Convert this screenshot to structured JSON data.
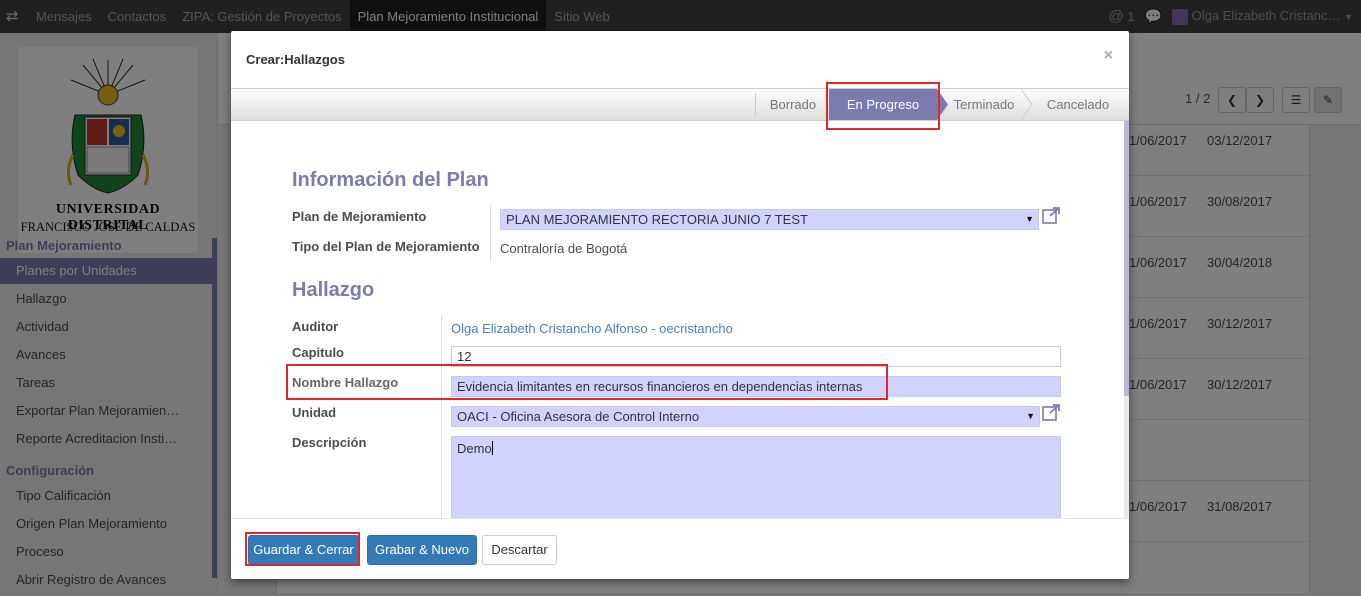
{
  "topbar": {
    "menus": [
      "Mensajes",
      "Contactos",
      "ZIPA: Gestión de Proyectos",
      "Plan Mejoramiento Institucional",
      "Sitio Web"
    ],
    "active_menu": "Plan Mejoramiento Institucional",
    "mentions_count": "1",
    "user_name": "Olga Elizabeth Cristanc…"
  },
  "logo": {
    "line1": "UNIVERSIDAD DISTRITAL",
    "line2": "FRANCISCO JOSÉ DE CALDAS"
  },
  "sidebar": {
    "section1": "Plan Mejoramiento",
    "items1": [
      "Planes por Unidades",
      "Hallazgo",
      "Actividad",
      "Avances",
      "Tareas",
      "Exportar Plan Mejoramien…",
      "Reporte Acreditacion Insti…"
    ],
    "section2": "Configuración",
    "items2": [
      "Tipo Calificación",
      "Origen Plan Mejoramiento",
      "Proceso",
      "Abrir Registro de Avances"
    ]
  },
  "background": {
    "pager": "1 / 2",
    "rows": [
      {
        "start": "1/06/2017",
        "end": "03/12/2017"
      },
      {
        "start": "1/06/2017",
        "end": "30/08/2017"
      },
      {
        "start": "1/06/2017",
        "end": "30/04/2018"
      },
      {
        "start": "1/06/2017",
        "end": "30/12/2017"
      },
      {
        "start": "1/06/2017",
        "end": "30/12/2017"
      },
      {
        "start": "1/06/2017",
        "end": "31/08/2017"
      }
    ]
  },
  "modal": {
    "title": "Crear:Hallazgos",
    "close": "×",
    "stages": [
      "Borrado",
      "En Progreso",
      "Terminado",
      "Cancelado"
    ],
    "current_stage": "En Progreso",
    "section_plan": "Información del Plan",
    "label_plan": "Plan de Mejoramiento",
    "value_plan": "PLAN MEJORAMIENTO RECTORIA JUNIO 7 TEST",
    "label_tipo": "Tipo del Plan de Mejoramiento",
    "value_tipo": "Contraloría de Bogotá",
    "section_hallazgo": "Hallazgo",
    "label_auditor": "Auditor",
    "value_auditor": "Olga Elizabeth Cristancho Alfonso - oecristancho",
    "label_capitulo": "Capitulo",
    "value_capitulo": "12",
    "label_nombre": "Nombre Hallazgo",
    "value_nombre": "Evidencia limitantes en recursos financieros en dependencias internas",
    "label_unidad": "Unidad",
    "value_unidad": "OACI - Oficina Asesora de Control Interno",
    "label_descripcion": "Descripción",
    "value_descripcion": "Demo",
    "btn_save_close": "Guardar & Cerrar",
    "btn_save_new": "Grabar & Nuevo",
    "btn_discard": "Descartar"
  },
  "colors": {
    "accent": "#7c7bad",
    "required_field": "#d2d2ff",
    "primary_button": "#337ab7",
    "highlight": "#e3262c"
  }
}
